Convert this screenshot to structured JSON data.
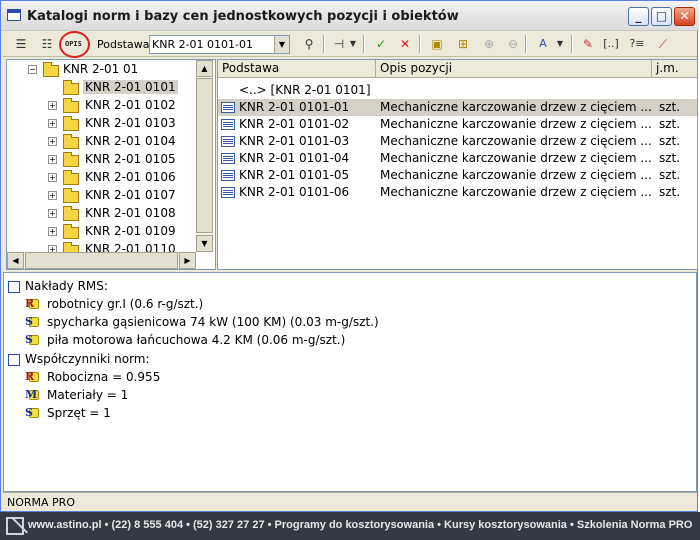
{
  "window": {
    "title": "Katalogi norm i bazy cen jednostkowych pozycji i obiektów",
    "controls": [
      "_",
      "□",
      "✕"
    ]
  },
  "toolbar": {
    "opis_label": "OPIS",
    "podstawa_label": "Podstawa:",
    "podstawa_value": "KNR 2-01 0101-01",
    "bracket_label": "[..]"
  },
  "tree": {
    "root": "KNR 2-01 01",
    "items": [
      "KNR 2-01 0101",
      "KNR 2-01 0102",
      "KNR 2-01 0103",
      "KNR 2-01 0104",
      "KNR 2-01 0105",
      "KNR 2-01 0106",
      "KNR 2-01 0107",
      "KNR 2-01 0108",
      "KNR 2-01 0109",
      "KNR 2-01 0110"
    ],
    "selected_index": 0
  },
  "list": {
    "columns": [
      "Podstawa",
      "Opis pozycji",
      "j.m."
    ],
    "parent_row": "<..> [KNR 2-01 0101]",
    "rows": [
      {
        "podstawa": "KNR 2-01 0101-01",
        "opis": "Mechaniczne karczowanie drzew z cięciem ...",
        "jm": "szt."
      },
      {
        "podstawa": "KNR 2-01 0101-02",
        "opis": "Mechaniczne karczowanie drzew z cięciem ...",
        "jm": "szt."
      },
      {
        "podstawa": "KNR 2-01 0101-03",
        "opis": "Mechaniczne karczowanie drzew z cięciem ...",
        "jm": "szt."
      },
      {
        "podstawa": "KNR 2-01 0101-04",
        "opis": "Mechaniczne karczowanie drzew z cięciem ...",
        "jm": "szt."
      },
      {
        "podstawa": "KNR 2-01 0101-05",
        "opis": "Mechaniczne karczowanie drzew z cięciem ...",
        "jm": "szt."
      },
      {
        "podstawa": "KNR 2-01 0101-06",
        "opis": "Mechaniczne karczowanie drzew z cięciem ...",
        "jm": "szt."
      }
    ],
    "selected_index": 0
  },
  "details": {
    "naklady_header": "Nakłady RMS:",
    "naklady": [
      {
        "type": "R",
        "text": "robotnicy gr.I  (0.6 r-g/szt.)"
      },
      {
        "type": "S",
        "text": "spycharka gąsienicowa 74 kW (100 KM)  (0.03 m-g/szt.)"
      },
      {
        "type": "S",
        "text": "piła motorowa łańcuchowa 4.2 KM  (0.06 m-g/szt.)"
      }
    ],
    "wspolczynniki_header": "Współczynniki norm:",
    "wspolczynniki": [
      {
        "type": "R",
        "text": "Robocizna = 0.955"
      },
      {
        "type": "M",
        "text": "Materiały = 1"
      },
      {
        "type": "S",
        "text": "Sprzęt = 1"
      }
    ]
  },
  "status": "NORMA PRO",
  "footer": "www.astino.pl  •  (22) 8 555 404  •  (52) 327 27 27  •  Programy do kosztorysowania  •  Kursy kosztorysowania  •  Szkolenia Norma PRO"
}
